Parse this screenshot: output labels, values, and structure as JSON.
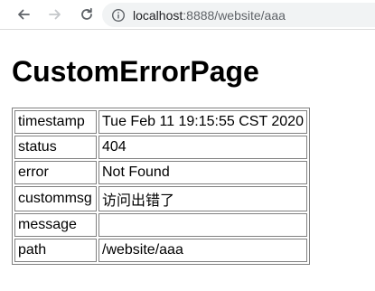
{
  "browser": {
    "back_icon": "arrow-left-icon",
    "forward_icon": "arrow-right-icon",
    "reload_icon": "reload-icon",
    "info_icon": "info-icon",
    "url_host": "localhost",
    "url_path": ":8888/website/aaa"
  },
  "page": {
    "title": "CustomErrorPage",
    "rows": [
      {
        "key": "timestamp",
        "value": "Tue Feb 11 19:15:55 CST 2020"
      },
      {
        "key": "status",
        "value": "404"
      },
      {
        "key": "error",
        "value": "Not Found"
      },
      {
        "key": "custommsg",
        "value": "访问出错了"
      },
      {
        "key": "message",
        "value": ""
      },
      {
        "key": "path",
        "value": "/website/aaa"
      }
    ]
  },
  "colors": {
    "toolbar_bg": "#ffffff",
    "omnibox_bg": "#f1f3f4",
    "table_border": "#808080",
    "icon_active": "#5f6368",
    "icon_disabled": "#c4c7ca"
  }
}
